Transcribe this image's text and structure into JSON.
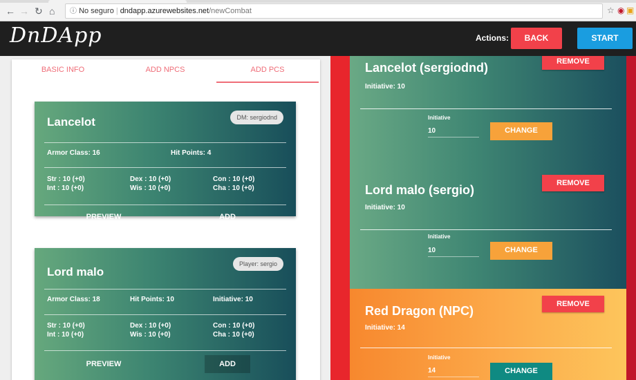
{
  "browser": {
    "security_label": "No seguro",
    "url_host": "dndapp.azurewebsites.net",
    "url_path": "/newCombat"
  },
  "header": {
    "logo": "DnDApp",
    "actions_label": "Actions:",
    "back_label": "BACK",
    "start_label": "START"
  },
  "tabs": [
    "BASIC INFO",
    "ADD NPCS",
    "ADD PCS"
  ],
  "active_tab": "ADD PCS",
  "pc_cards": [
    {
      "name": "Lancelot",
      "badge": "DM: sergiodnd",
      "armor_class": "Armor Class: 16",
      "hit_points": "Hit Points: 4",
      "initiative": "",
      "str": "Str : 10 (+0)",
      "int": "Int : 10 (+0)",
      "dex": "Dex : 10 (+0)",
      "wis": "Wis : 10 (+0)",
      "con": "Con : 10 (+0)",
      "cha": "Cha : 10 (+0)",
      "preview_label": "PREVIEW",
      "add_label": "ADD"
    },
    {
      "name": "Lord malo",
      "badge": "Player: sergio",
      "armor_class": "Armor Class: 18",
      "hit_points": "Hit Points: 10",
      "initiative": "Initiative: 10",
      "str": "Str : 10 (+0)",
      "int": "Int : 10 (+0)",
      "dex": "Dex : 10 (+0)",
      "wis": "Wis : 10 (+0)",
      "con": "Con : 10 (+0)",
      "cha": "Cha : 10 (+0)",
      "preview_label": "PREVIEW",
      "add_label": "ADD"
    }
  ],
  "combatants": [
    {
      "name": "Lancelot (sergiodnd)",
      "initiative_text": "Initiative: 10",
      "remove_label": "REMOVE",
      "field_label": "Initiative",
      "field_value": "10",
      "change_label": "CHANGE"
    },
    {
      "name": "Lord malo (sergio)",
      "initiative_text": "Initiative: 10",
      "remove_label": "REMOVE",
      "field_label": "Initiative",
      "field_value": "10",
      "change_label": "CHANGE"
    },
    {
      "name": "Red Dragon (NPC)",
      "initiative_text": "Initiative: 14",
      "remove_label": "REMOVE",
      "field_label": "Initiative",
      "field_value": "14",
      "change_label": "CHANGE"
    }
  ],
  "colors": {
    "danger": "#f2414a",
    "primary": "#1a9de0",
    "tab_accent": "#ef6d78",
    "change_orange": "#f7a23a",
    "change_teal": "#0f8a82",
    "side_red": "#e8262c"
  }
}
